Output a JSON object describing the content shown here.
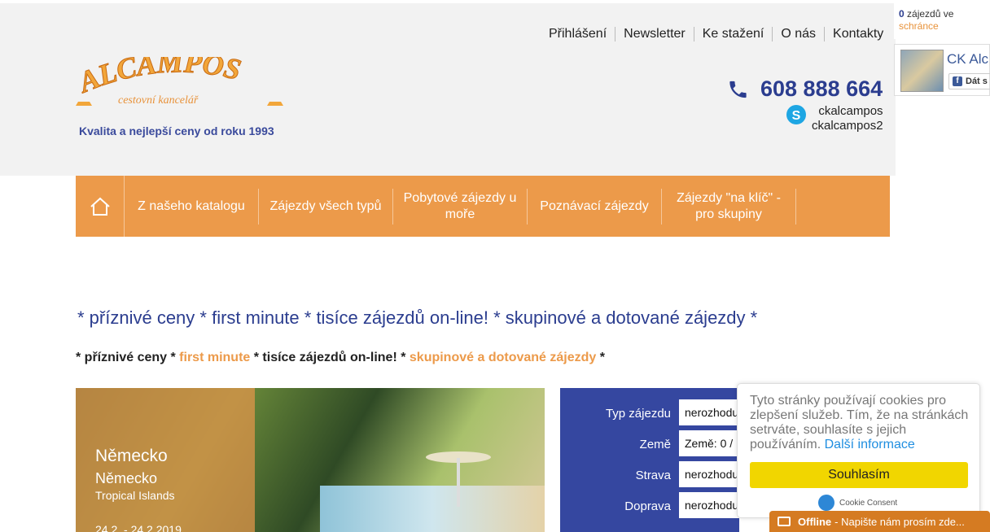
{
  "header": {
    "logo_text": "ALCAMPOS",
    "logo_sub": "cestovní kancelář",
    "tagline": "Kvalita a nejlepší ceny od roku 1993",
    "top_nav": [
      "Přihlášení",
      "Newsletter",
      "Ke stažení",
      "O nás",
      "Kontakty"
    ],
    "phone": "608 888 664",
    "skype": [
      "ckalcampos",
      "ckalcampos2"
    ]
  },
  "cart": {
    "count": "0",
    "text": "zájezdů ve",
    "link": "schránce"
  },
  "facebook": {
    "name": "CK Alc",
    "button": "Dát s"
  },
  "main_nav": [
    "Z našeho katalogu",
    "Zájezdy všech typů",
    "Pobytové zájezdy u moře",
    "Poznávací zájezdy",
    "Zájezdy \"na klíč\" - pro skupiny"
  ],
  "slogan_main": "* příznivé ceny * first minute * tisíce zájezdů on-line! * skupinové a dotované zájezdy *",
  "slogan_sub": {
    "p1": "*  příznivé ceny  * ",
    "p2": "first minute",
    "p3": "  *  tisíce zájezdů on-line! * ",
    "p4": "skupinové a dotované zájezdy",
    "p5": " *"
  },
  "promo": {
    "country": "Německo",
    "country2": "Německo",
    "place": "Tropical Islands",
    "dates": "24.2. - 24.2.2019"
  },
  "search": {
    "rows": [
      {
        "label": "Typ zájezdu",
        "value": "nerozhodu"
      },
      {
        "label": "Země",
        "value": "Země: 0 /"
      },
      {
        "label": "Strava",
        "value": "nerozhodu"
      },
      {
        "label": "Doprava",
        "value": "nerozhodu"
      }
    ]
  },
  "cookie": {
    "message": "Tyto stránky používají cookies pro zlepšení služeb. Tím, že na stránkách setrváte, souhlasíte s jejich používáním.",
    "link": "Další informace",
    "button": "Souhlasím",
    "brand": "Cookie Consent"
  },
  "chat": {
    "status": "Offline",
    "text": "- Napište nám prosím zde..."
  },
  "colors": {
    "brand_blue": "#2b3d8f",
    "brand_orange": "#ec9a4a",
    "cookie_button": "#f1d600"
  }
}
